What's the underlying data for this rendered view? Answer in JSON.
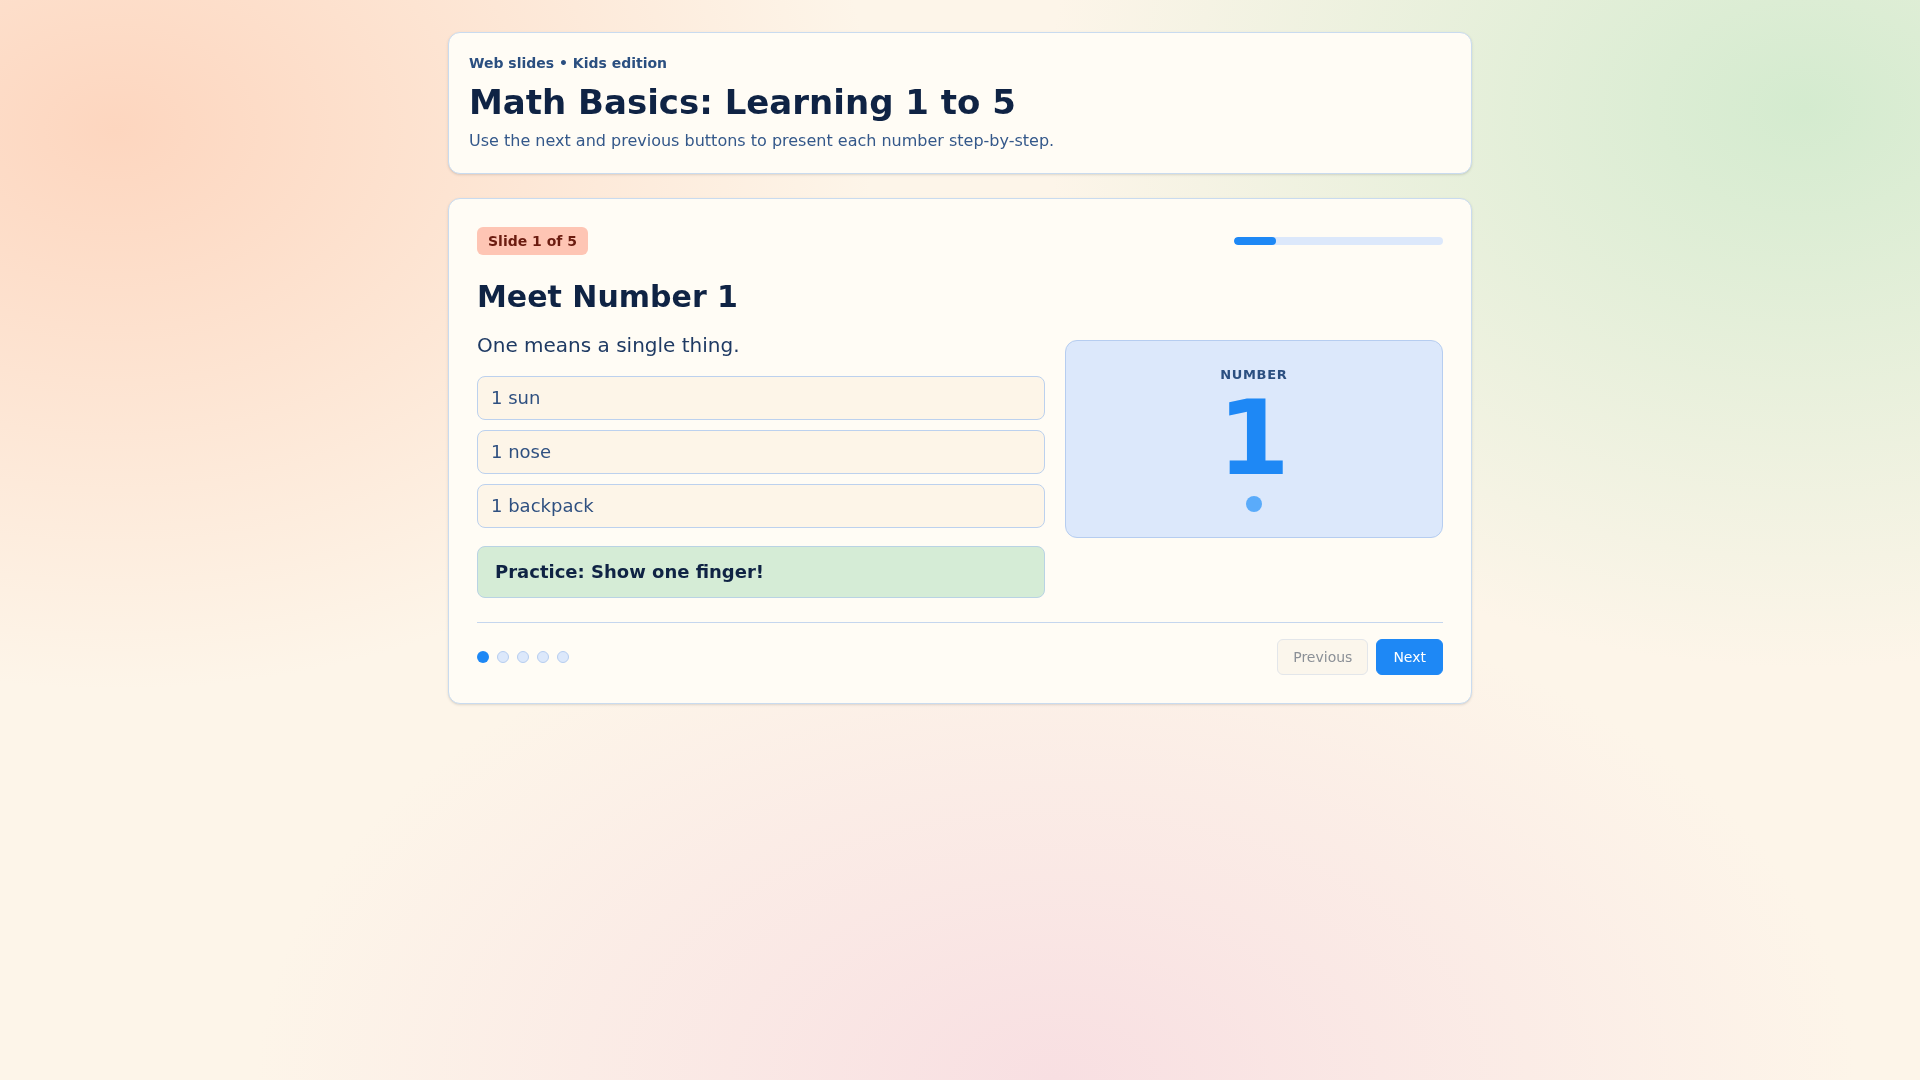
{
  "header": {
    "eyebrow": "Web slides • Kids edition",
    "title": "Math Basics: Learning 1 to 5",
    "description": "Use the next and previous buttons to present each number step-by-step."
  },
  "slide": {
    "badge": "Slide 1 of 5",
    "progress": {
      "level": 0.2
    },
    "title": "Meet Number 1",
    "subtitle": "One means a single thing.",
    "examples": [
      "1 sun",
      "1 nose",
      "1 backpack"
    ],
    "practice": "Practice: Show one finger!",
    "number_card": {
      "label": "NUMBER",
      "value": "1",
      "counters": [
        {
          "kind": "dot"
        }
      ]
    }
  },
  "pager": {
    "dots": [
      {
        "selected": true
      },
      {
        "selected": false
      },
      {
        "selected": false
      },
      {
        "selected": false
      },
      {
        "selected": false
      }
    ]
  },
  "buttons": [
    {
      "label": "Previous",
      "disabled": true
    },
    {
      "label": "Next",
      "disabled": false
    }
  ]
}
